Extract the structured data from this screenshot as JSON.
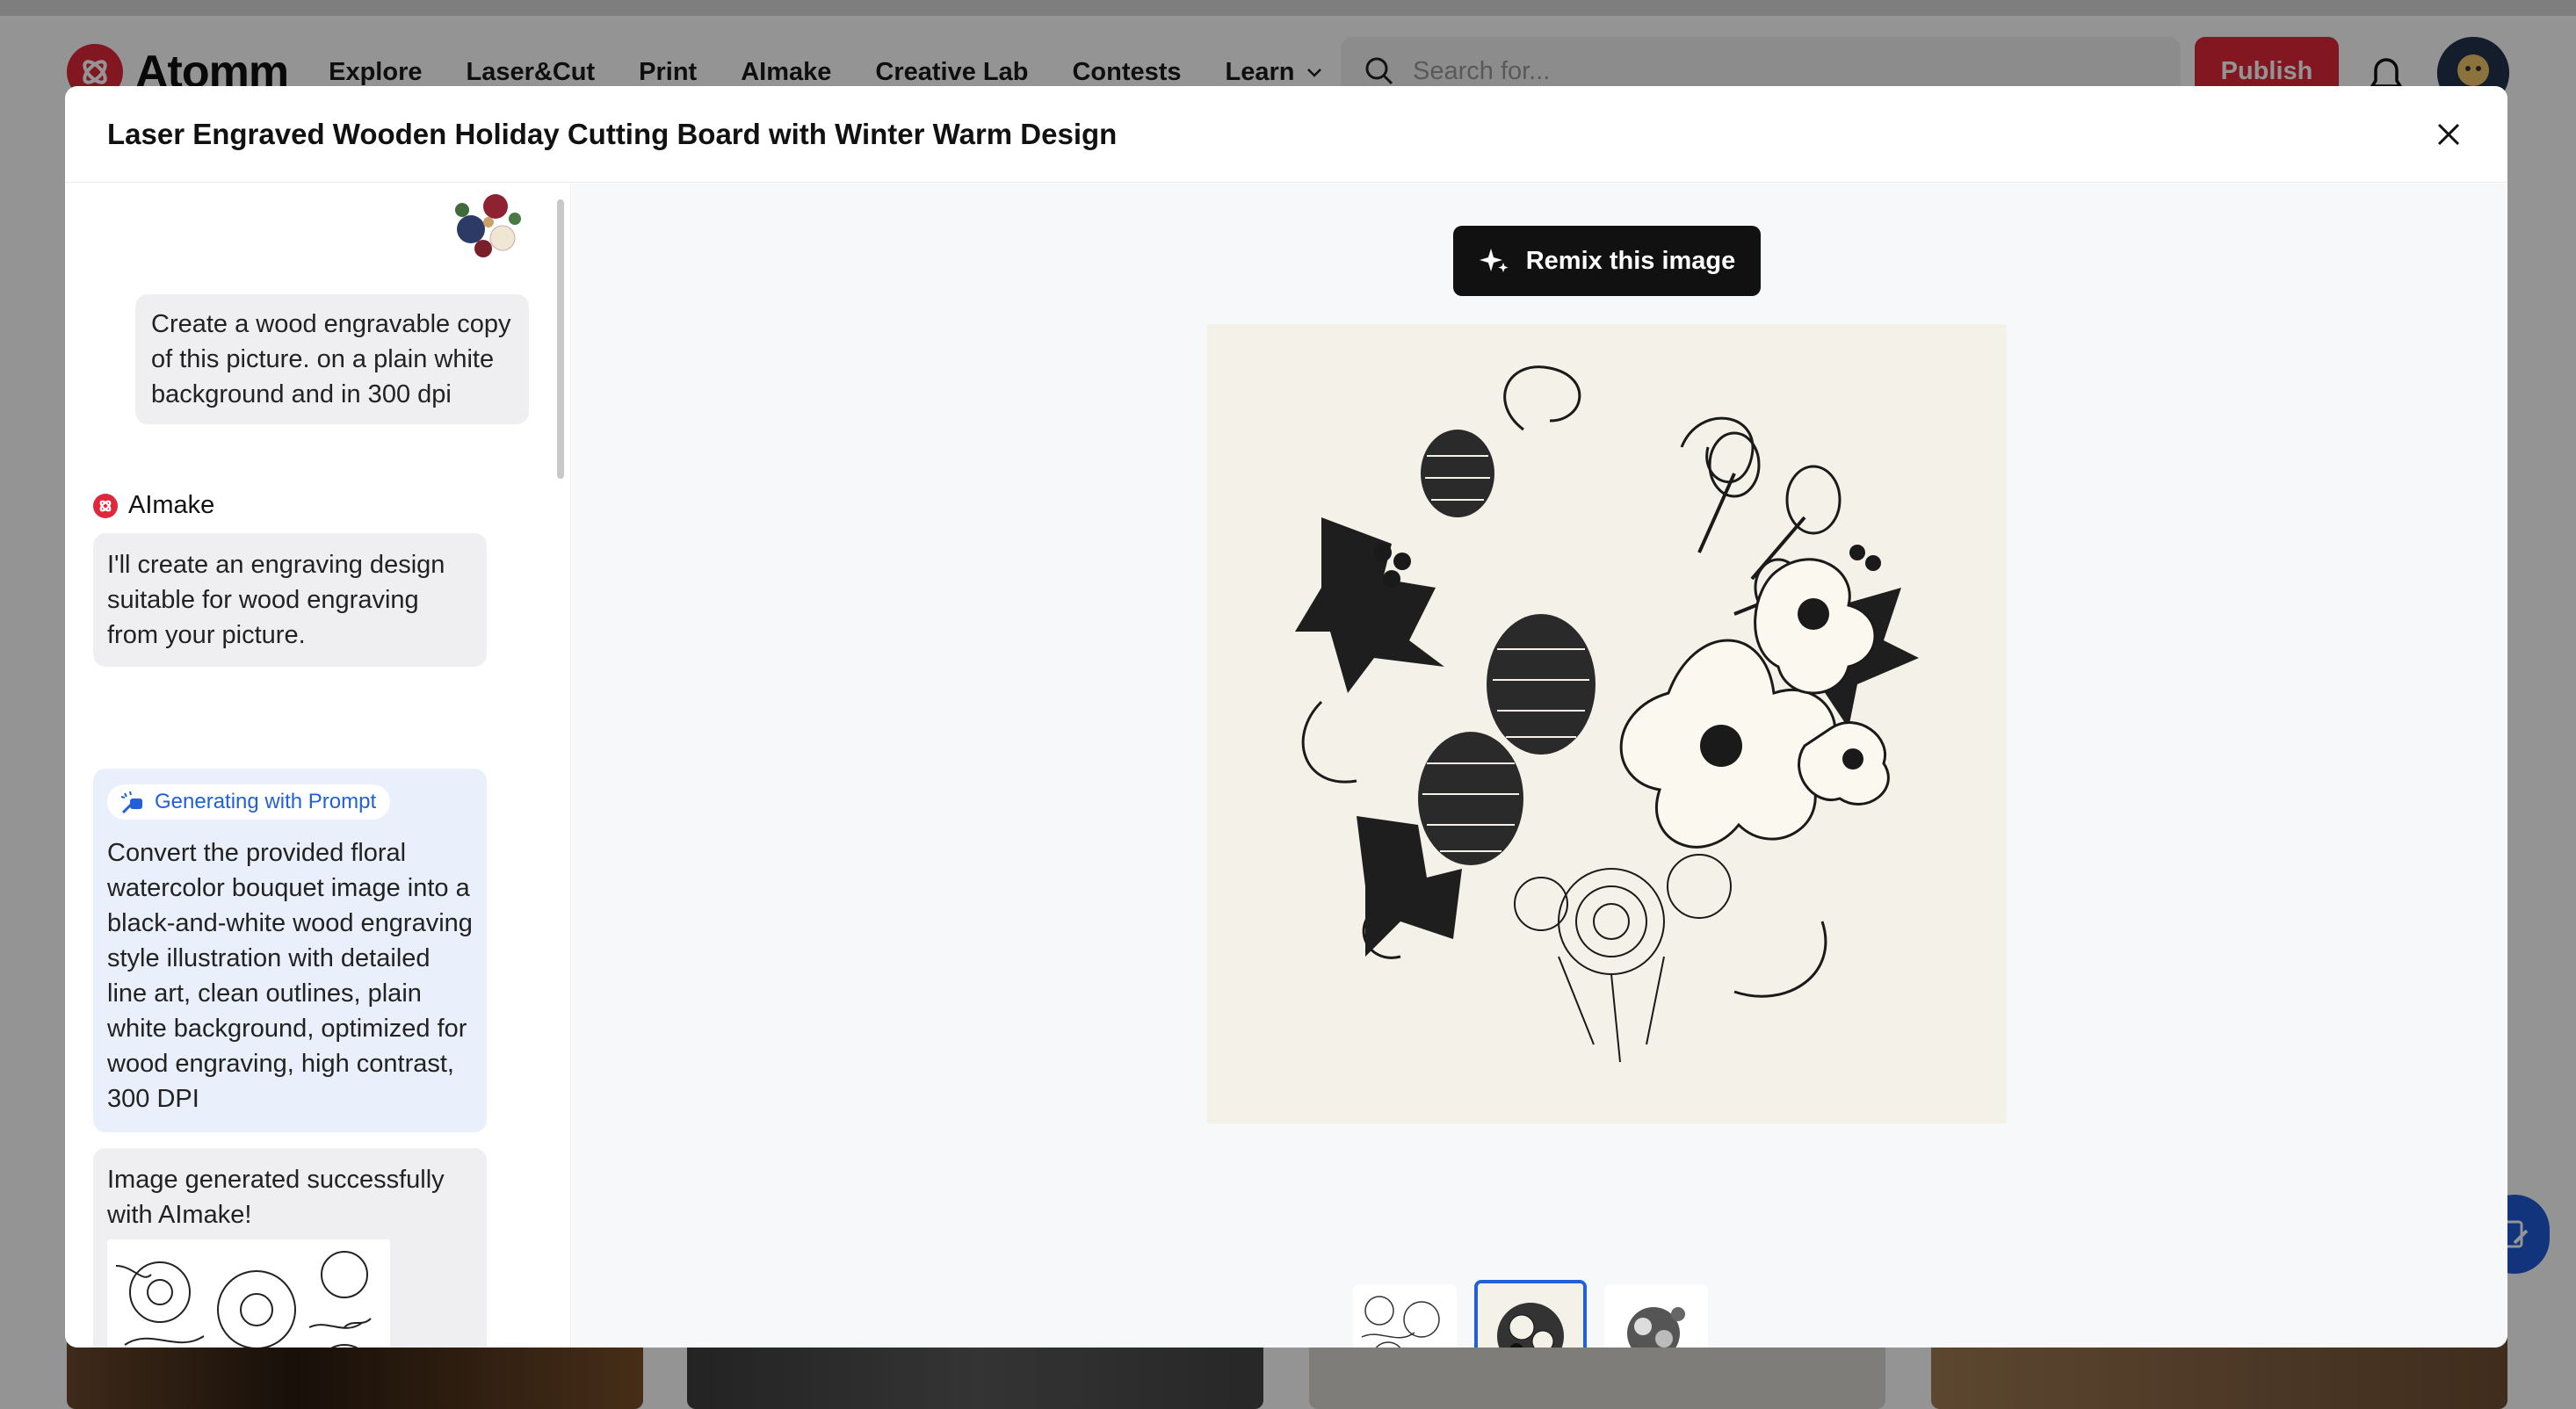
{
  "site": {
    "logo_text": "Atomm",
    "nav": [
      "Explore",
      "Laser&Cut",
      "Print",
      "AImake",
      "Creative Lab",
      "Contests",
      "Learn"
    ],
    "search_placeholder": "Search for...",
    "publish_label": "Publish"
  },
  "modal": {
    "title": "Laser Engraved Wooden Holiday Cutting Board with Winter Warm Design",
    "close_label": "×"
  },
  "chat": {
    "user_message": "Create a wood engravable copy of this picture. on a plain white background and in 300 dpi",
    "bot_name": "AImake",
    "bot_reply": "I'll create an engraving design suitable for wood engraving from your picture.",
    "prompt_chip": "Generating with Prompt",
    "prompt_text": "Convert the provided floral watercolor bouquet image into a black-and-white wood engraving style illustration with detailed line art, clean outlines, plain white background, optimized for wood engraving, high contrast, 300 DPI",
    "result_text": "Image generated successfully with AImake!"
  },
  "viewer": {
    "remix_label": "Remix this image",
    "thumbnails": [
      "line-art-floral",
      "engraved-bouquet",
      "sketch-bouquet"
    ],
    "active_thumbnail": 1
  },
  "colors": {
    "brand_red": "#e0283c",
    "accent_blue": "#2160d8",
    "remix_bg": "#111111"
  }
}
